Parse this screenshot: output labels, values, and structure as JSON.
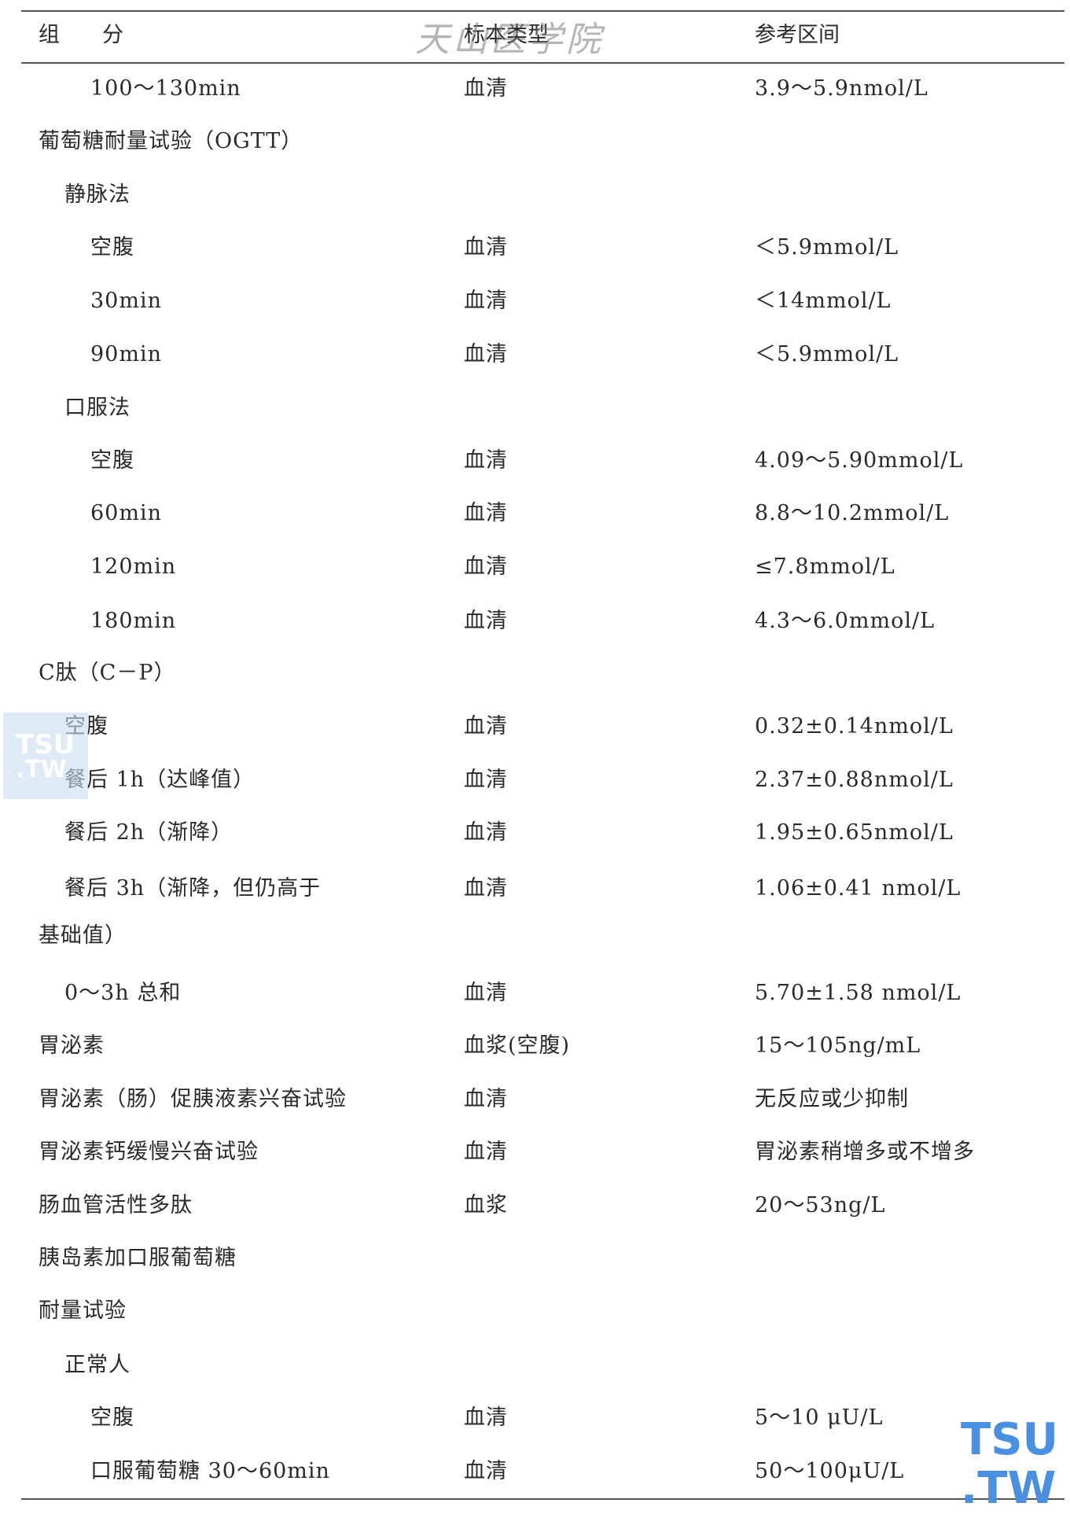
{
  "header": {
    "col1": "组　　分",
    "col2": "标本类型",
    "col3": "参考区间"
  },
  "watermarks": {
    "top": "天山医学院",
    "logo_left": [
      "TSU",
      ".TW"
    ],
    "logo_right": [
      "TSU",
      ".TW"
    ]
  },
  "rows": [
    {
      "indent": 2,
      "name": "100～130min",
      "specimen": "血清",
      "range": "3.9～5.9nmol/L"
    },
    {
      "indent": 0,
      "name": "葡萄糖耐量试验（OGTT）",
      "specimen": "",
      "range": ""
    },
    {
      "indent": 1,
      "name": "静脉法",
      "specimen": "",
      "range": ""
    },
    {
      "indent": 2,
      "name": "空腹",
      "specimen": "血清",
      "range": "＜5.9mmol/L"
    },
    {
      "indent": 2,
      "name": "30min",
      "specimen": "血清",
      "range": "＜14mmol/L"
    },
    {
      "indent": 2,
      "name": "90min",
      "specimen": "血清",
      "range": "＜5.9mmol/L"
    },
    {
      "indent": 1,
      "name": "口服法",
      "specimen": "",
      "range": ""
    },
    {
      "indent": 2,
      "name": "空腹",
      "specimen": "血清",
      "range": "4.09～5.90mmol/L"
    },
    {
      "indent": 2,
      "name": "60min",
      "specimen": "血清",
      "range": "8.8～10.2mmol/L"
    },
    {
      "indent": 2,
      "name": "120min",
      "specimen": "血清",
      "range": "≤7.8mmol/L"
    },
    {
      "indent": 2,
      "name": "180min",
      "specimen": "血清",
      "range": "4.3～6.0mmol/L"
    },
    {
      "indent": 0,
      "name": "C肽（C－P）",
      "specimen": "",
      "range": ""
    },
    {
      "indent": 1,
      "name": "空腹",
      "specimen": "血清",
      "range": "0.32±0.14nmol/L"
    },
    {
      "indent": 1,
      "name": "餐后 1h（达峰值）",
      "specimen": "血清",
      "range": "2.37±0.88nmol/L"
    },
    {
      "indent": 1,
      "name": "餐后 2h（渐降）",
      "specimen": "血清",
      "range": "1.95±0.65nmol/L"
    },
    {
      "indent": 1,
      "name": "餐后 3h（渐降，但仍高于",
      "specimen": "血清",
      "range": "1.06±0.41 nmol/L"
    },
    {
      "indent": 0,
      "name": "基础值）",
      "specimen": "",
      "range": ""
    },
    {
      "indent": 1,
      "name": "0～3h 总和",
      "specimen": "血清",
      "range": "5.70±1.58 nmol/L"
    },
    {
      "indent": 0,
      "name": "胃泌素",
      "specimen": "血浆(空腹)",
      "range": "15～105ng/mL"
    },
    {
      "indent": 0,
      "name": "胃泌素（肠）促胰液素兴奋试验",
      "specimen": "血清",
      "range": "无反应或少抑制"
    },
    {
      "indent": 0,
      "name": "胃泌素钙缓慢兴奋试验",
      "specimen": "血清",
      "range": "胃泌素稍增多或不增多"
    },
    {
      "indent": 0,
      "name": "肠血管活性多肽",
      "specimen": "血浆",
      "range": "20～53ng/L"
    },
    {
      "indent": 0,
      "name": "胰岛素加口服葡萄糖",
      "specimen": "",
      "range": ""
    },
    {
      "indent": 0,
      "name": "耐量试验",
      "specimen": "",
      "range": ""
    },
    {
      "indent": 1,
      "name": "正常人",
      "specimen": "",
      "range": ""
    },
    {
      "indent": 2,
      "name": "空腹",
      "specimen": "血清",
      "range": "5～10 μU/L"
    },
    {
      "indent": 2,
      "name": "口服葡萄糖 30～60min",
      "specimen": "血清",
      "range": "50～100μU/L"
    }
  ]
}
